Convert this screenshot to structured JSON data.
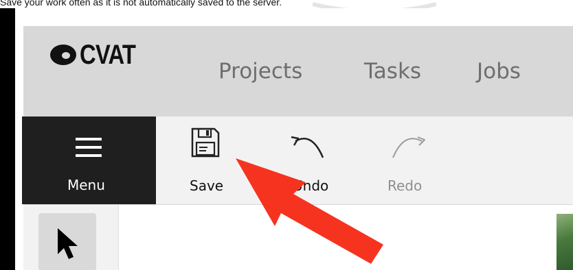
{
  "caption": {
    "text": "Save your work often as it is not automatically saved to the server."
  },
  "header": {
    "logo_text": "CVAT",
    "nav": [
      {
        "label": "Projects"
      },
      {
        "label": "Tasks"
      },
      {
        "label": "Jobs"
      }
    ]
  },
  "toolbar": {
    "menu_label": "Menu",
    "save_label": "Save",
    "undo_label": "Undo",
    "redo_label": "Redo"
  },
  "icons": {
    "menu": "hamburger-icon",
    "save": "floppy-disk-icon",
    "undo": "undo-arrow-icon",
    "redo": "redo-arrow-icon",
    "cursor": "cursor-arrow-icon",
    "annotation": "red-pointer-arrow"
  },
  "colors": {
    "header_bg": "#d8d8d8",
    "menu_bg": "#1f1f1f",
    "nav_text": "#6e6e6e",
    "annotation_arrow": "#f5331f"
  }
}
